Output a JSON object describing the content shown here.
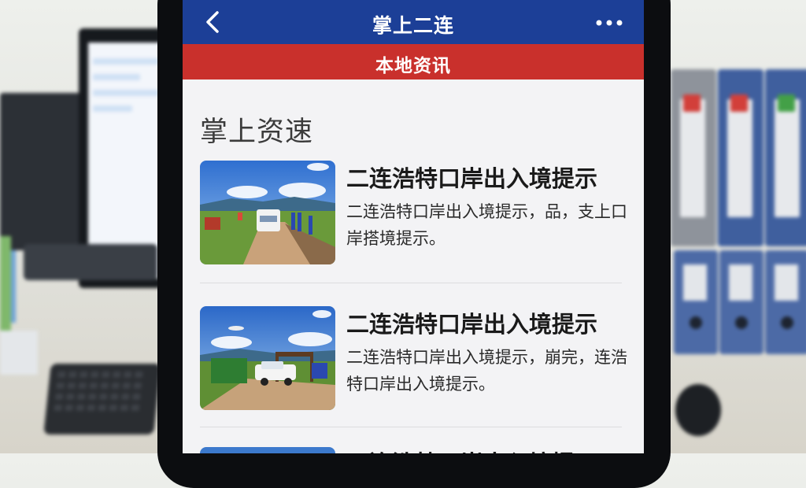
{
  "header": {
    "title": "掌上二连",
    "back_icon": "chevron-left-icon",
    "more_icon": "more-horizontal-icon"
  },
  "tab": {
    "label": "本地资讯"
  },
  "section": {
    "title": "掌上资速"
  },
  "news": [
    {
      "title": "二连浩特口岸出入境提示",
      "desc": "二连浩特口岸出入境提示，品，支上口岸搭境提示。"
    },
    {
      "title": "二连浩特口岸出入境提示",
      "desc": "二连浩特口岸出入境提示，崩完，连浩特口岸出入境提示。"
    },
    {
      "title": "二连浩特口岸出入境提示"
    }
  ],
  "colors": {
    "header_blue": "#1c3f97",
    "tab_red": "#c9302c"
  }
}
